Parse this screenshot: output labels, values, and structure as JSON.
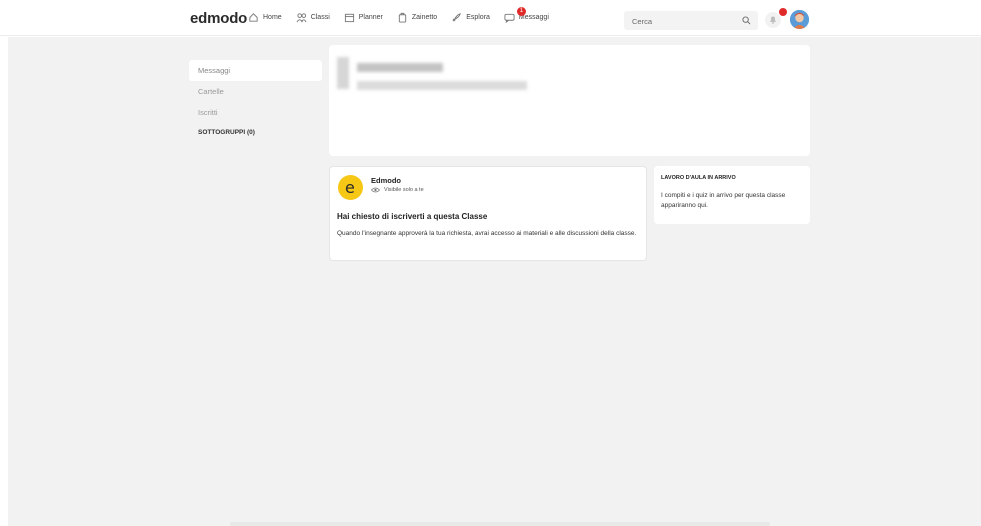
{
  "header": {
    "logo": "edmodo",
    "nav": [
      {
        "label": "Home",
        "icon": "home-icon"
      },
      {
        "label": "Classi",
        "icon": "classes-icon"
      },
      {
        "label": "Planner",
        "icon": "planner-icon"
      },
      {
        "label": "Zainetto",
        "icon": "backpack-icon"
      },
      {
        "label": "Esplora",
        "icon": "explore-icon"
      },
      {
        "label": "Messaggi",
        "icon": "messages-icon",
        "badge": "1"
      }
    ],
    "search_placeholder": "Cerca",
    "accent_red": "#e02b2b"
  },
  "sidebar": {
    "items": [
      {
        "label": "Messaggi",
        "active": true
      },
      {
        "label": "Cartelle",
        "active": false
      },
      {
        "label": "Iscritti",
        "active": false
      }
    ],
    "subgroups_label": "SOTTOGRUPPI (0)"
  },
  "post": {
    "author": "Edmodo",
    "visibility": "Visibile solo a te",
    "title": "Hai chiesto di iscriverti a questa Classe",
    "body": "Quando l'insegnante approverà la tua richiesta, avrai accesso ai materiali e alle discussioni della classe.",
    "logo_color": "#f6c714"
  },
  "upcoming": {
    "title": "LAVORO D'AULA IN ARRIVO",
    "body": "I compiti e i quiz in arrivo per questa classe appariranno qui."
  }
}
